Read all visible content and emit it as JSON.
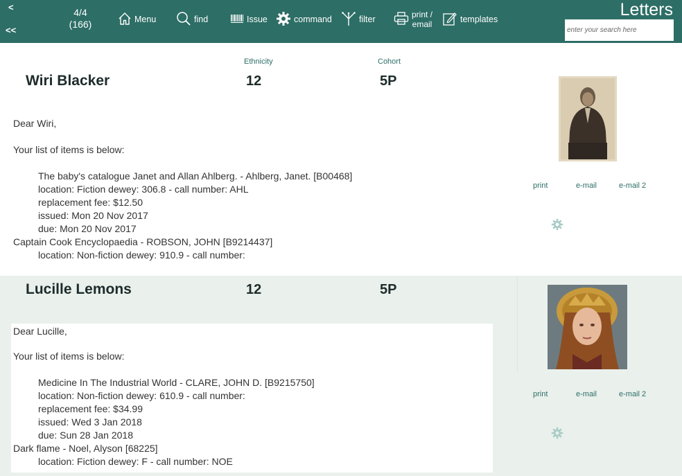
{
  "toolbar": {
    "prev_label": "<",
    "first_label": "<<",
    "counter_line1": "4/4",
    "counter_line2": "(166)",
    "menu_label": "Menu",
    "find_label": "find",
    "issue_label": "Issue",
    "command_label": "command",
    "filter_label": "filter",
    "print_email_line1": "print /",
    "print_email_line2": "email",
    "templates_label": "templates",
    "app_title": "Letters",
    "search_placeholder": "enter your search here"
  },
  "colors": {
    "accent": "#2d6e66",
    "alt_row": "#eaf0ec",
    "gear": "#a9cdc6"
  },
  "column_labels": {
    "ethnicity": "Ethnicity",
    "cohort": "Cohort"
  },
  "records": [
    {
      "name": "Wiri Blacker",
      "ethnicity": "12",
      "cohort": "5P",
      "letter": {
        "greeting": "Dear Wiri,",
        "intro": "Your list of items is below:",
        "lines": [
          {
            "text": "The baby's catalogue Janet and Allan Ahlberg. - Ahlberg, Janet. [B00468]",
            "indent": true
          },
          {
            "text": "location: Fiction dewey: 306.8 - call number: AHL",
            "indent": true
          },
          {
            "text": "replacement fee: $12.50",
            "indent": true
          },
          {
            "text": "issued: Mon 20 Nov 2017",
            "indent": true
          },
          {
            "text": "due: Mon 20 Nov 2017",
            "indent": true
          },
          {
            "text": "Captain Cook Encyclopaedia - ROBSON, JOHN [B9214437]",
            "indent": false
          },
          {
            "text": "location: Non-fiction dewey: 910.9 - call number:",
            "indent": true
          }
        ]
      },
      "actions": {
        "print": "print",
        "email": "e-mail",
        "email2": "e-mail 2"
      }
    },
    {
      "name": "Lucille Lemons",
      "ethnicity": "12",
      "cohort": "5P",
      "letter": {
        "greeting": "Dear Lucille,",
        "intro": "Your list of items is below:",
        "lines": [
          {
            "text": "Medicine In The Industrial World - CLARE, JOHN D. [B9215750]",
            "indent": true
          },
          {
            "text": "location: Non-fiction dewey: 610.9 - call number:",
            "indent": true
          },
          {
            "text": "replacement fee: $34.99",
            "indent": true
          },
          {
            "text": "issued: Wed 3 Jan 2018",
            "indent": true
          },
          {
            "text": "due: Sun 28 Jan 2018",
            "indent": true
          },
          {
            "text": "Dark flame - Noel, Alyson [68225]",
            "indent": false
          },
          {
            "text": "location: Fiction dewey: F - call number: NOE",
            "indent": true
          }
        ]
      },
      "actions": {
        "print": "print",
        "email": "e-mail",
        "email2": "e-mail 2"
      }
    }
  ]
}
